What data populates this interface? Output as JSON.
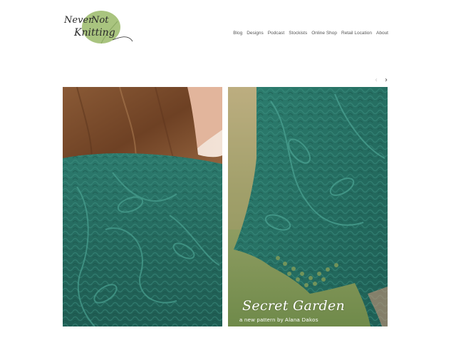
{
  "site": {
    "logo_words": [
      "Never",
      "Not",
      "Knitting"
    ]
  },
  "nav": {
    "items": [
      {
        "label": "Blog"
      },
      {
        "label": "Designs"
      },
      {
        "label": "Podcast"
      },
      {
        "label": "Stockists"
      },
      {
        "label": "Online Shop"
      },
      {
        "label": "Retail Location"
      },
      {
        "label": "About"
      }
    ]
  },
  "slider": {
    "prev_icon": "chevron-left-icon",
    "next_icon": "chevron-right-icon",
    "prev_glyph": "‹",
    "next_glyph": "›"
  },
  "hero": {
    "title": "Secret Garden",
    "subtitle": "a new pattern by Alana Dakos"
  },
  "colors": {
    "logo_leaf": "#a9c47f",
    "knit_green": "#2f7b6e",
    "nav_text": "#555555",
    "background": "#ffffff"
  }
}
